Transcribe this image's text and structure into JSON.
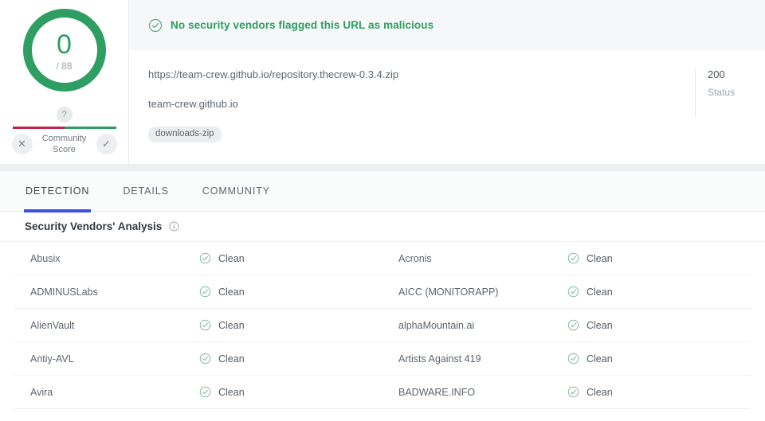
{
  "score": {
    "value": "0",
    "total": "/ 88",
    "ring_color": "#2e9e62"
  },
  "community": {
    "question_mark": "?",
    "label_line1": "Community",
    "label_line2": "Score",
    "downvote_icon": "x-icon",
    "upvote_icon": "check-icon",
    "bar_negative_color": "#c0264b",
    "bar_positive_color": "#2e9e62"
  },
  "verdict": {
    "icon": "check-circle-icon",
    "text": "No security vendors flagged this URL as malicious",
    "color": "#2e9e62"
  },
  "meta": {
    "url": "https://team-crew.github.io/repository.thecrew-0.3.4.zip",
    "host": "team-crew.github.io",
    "tags": [
      "downloads-zip"
    ],
    "status_code": "200",
    "status_label": "Status"
  },
  "tabs": [
    {
      "label": "DETECTION",
      "active": true
    },
    {
      "label": "DETAILS",
      "active": false
    },
    {
      "label": "COMMUNITY",
      "active": false
    }
  ],
  "analysis": {
    "title": "Security Vendors' Analysis",
    "info_icon": "info-icon"
  },
  "vendors": [
    {
      "left_name": "Abusix",
      "left_verdict": "Clean",
      "right_name": "Acronis",
      "right_verdict": "Clean"
    },
    {
      "left_name": "ADMINUSLabs",
      "left_verdict": "Clean",
      "right_name": "AICC (MONITORAPP)",
      "right_verdict": "Clean"
    },
    {
      "left_name": "AlienVault",
      "left_verdict": "Clean",
      "right_name": "alphaMountain.ai",
      "right_verdict": "Clean"
    },
    {
      "left_name": "Antiy-AVL",
      "left_verdict": "Clean",
      "right_name": "Artists Against 419",
      "right_verdict": "Clean"
    },
    {
      "left_name": "Avira",
      "left_verdict": "Clean",
      "right_name": "BADWARE.INFO",
      "right_verdict": "Clean"
    }
  ]
}
